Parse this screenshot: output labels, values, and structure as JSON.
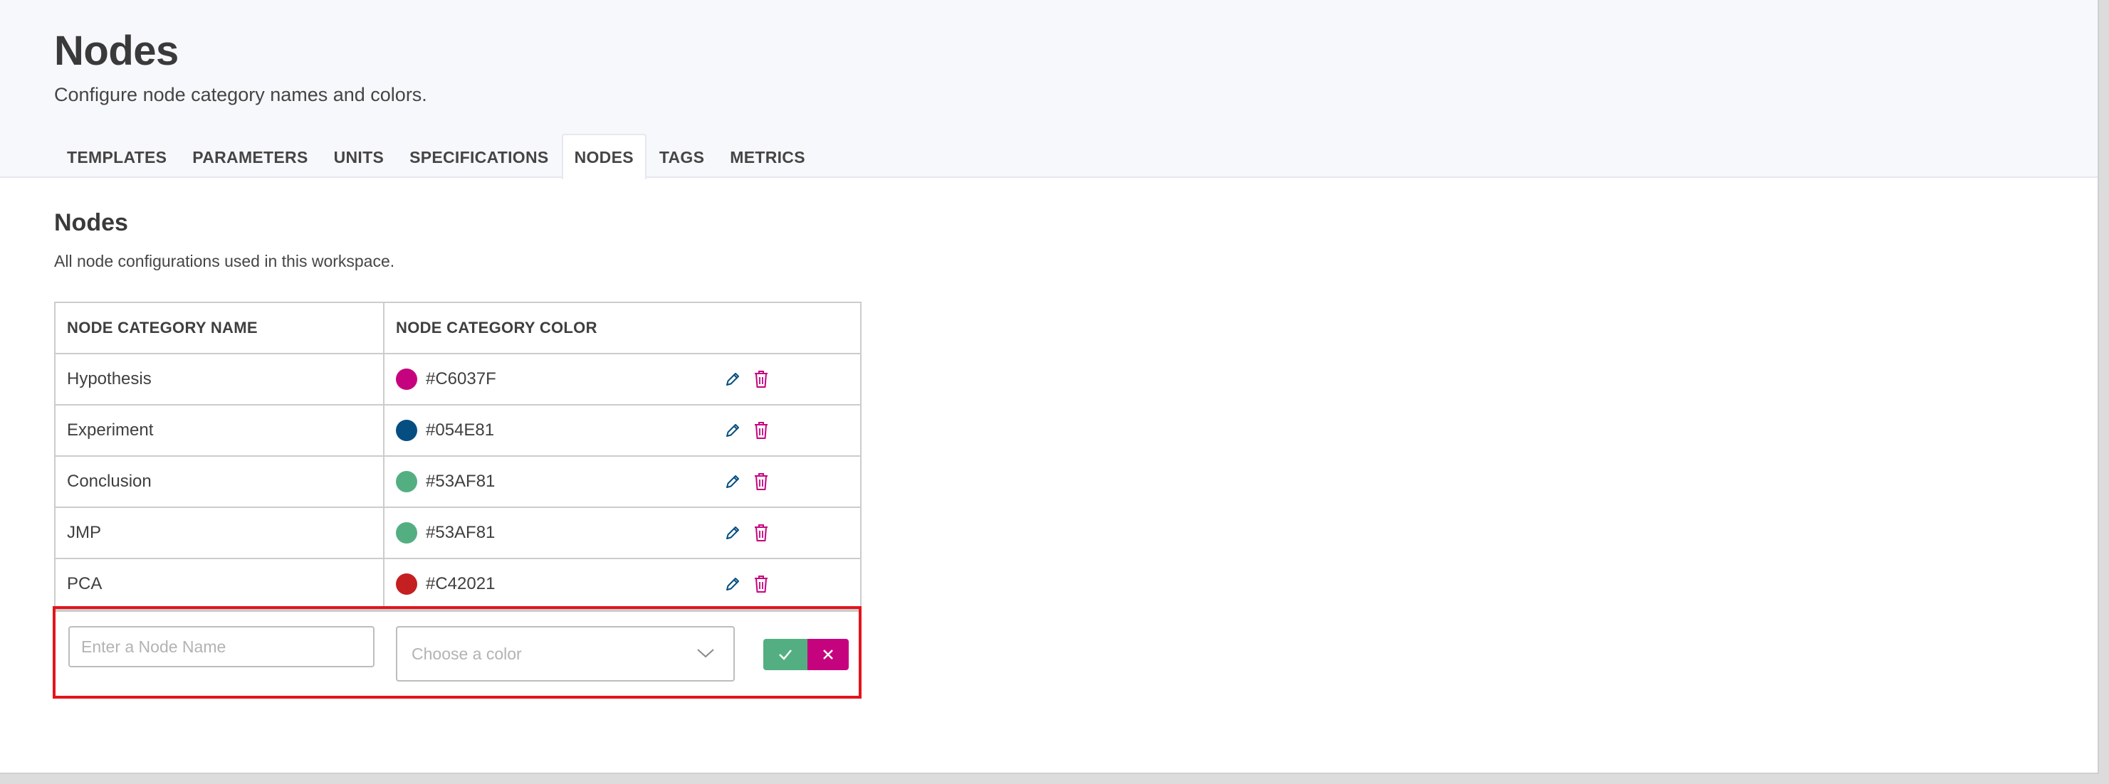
{
  "header": {
    "title": "Nodes",
    "subtitle": "Configure node category names and colors."
  },
  "tabs": [
    {
      "label": "TEMPLATES",
      "active": false
    },
    {
      "label": "PARAMETERS",
      "active": false
    },
    {
      "label": "UNITS",
      "active": false
    },
    {
      "label": "SPECIFICATIONS",
      "active": false
    },
    {
      "label": "NODES",
      "active": true
    },
    {
      "label": "TAGS",
      "active": false
    },
    {
      "label": "METRICS",
      "active": false
    }
  ],
  "section": {
    "title": "Nodes",
    "description": "All node configurations used in this workspace."
  },
  "table": {
    "columns": [
      "NODE CATEGORY NAME",
      "NODE CATEGORY COLOR"
    ],
    "rows": [
      {
        "name": "Hypothesis",
        "color": "#C6037F"
      },
      {
        "name": "Experiment",
        "color": "#054E81"
      },
      {
        "name": "Conclusion",
        "color": "#53AF81"
      },
      {
        "name": "JMP",
        "color": "#53AF81"
      },
      {
        "name": "PCA",
        "color": "#C42021"
      }
    ]
  },
  "new_row": {
    "name_placeholder": "Enter a Node Name",
    "color_placeholder": "Choose a color"
  },
  "colors": {
    "edit_icon": "#054E81",
    "delete_icon": "#C6037F",
    "confirm": "#53AF81",
    "cancel": "#C6037F",
    "highlight": "#E3141B"
  },
  "icons": {
    "edit": "pencil-icon",
    "delete": "trash-icon",
    "confirm": "check-icon",
    "cancel": "close-icon",
    "dropdown": "chevron-down-icon"
  }
}
